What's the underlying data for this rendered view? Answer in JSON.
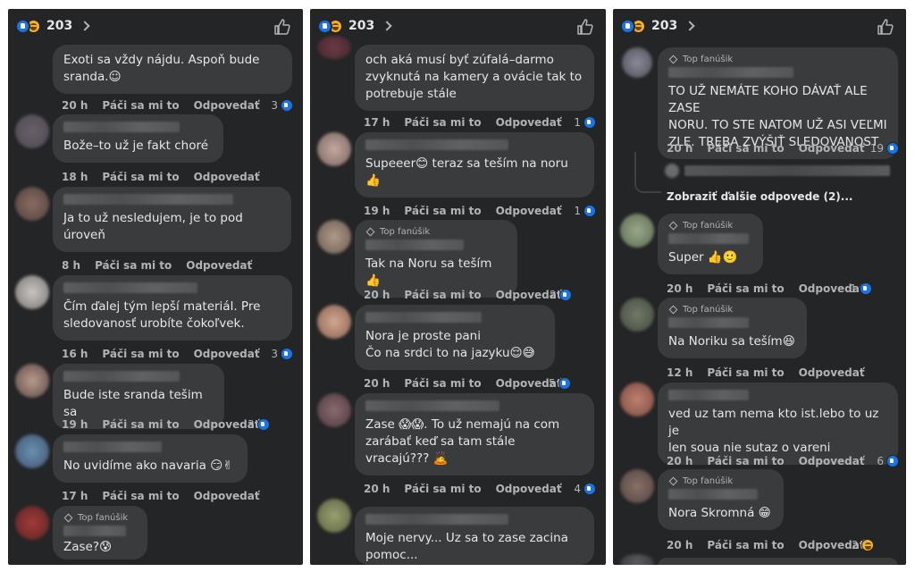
{
  "header": {
    "reaction_count": "203"
  },
  "actions": {
    "like": "Páči sa mi to",
    "reply": "Odpovedať"
  },
  "badge": {
    "top_fan": "Top fanúšik"
  },
  "panel1": {
    "c1": {
      "text": "Exoti sa vždy nájdu. Aspoň bude\nsranda.☺",
      "time": "20 h",
      "likes": "3"
    },
    "c2": {
      "text": "Bože–to už je fakt choré",
      "time": "18 h"
    },
    "c3": {
      "text": "Ja to už nesledujem, je to pod\núroveň",
      "time": "8 h"
    },
    "c4": {
      "text": "Čím ďalej tým lepší materiál. Pre\nsledovanosť urobíte čokoľvek.",
      "time": "16 h",
      "likes": "3"
    },
    "c5": {
      "text": "Bude iste sranda tešim sa",
      "time": "19 h",
      "likes": "3"
    },
    "c6": {
      "text": "No uvidíme ako navaria 😏✌",
      "time": "17 h"
    },
    "c7": {
      "text": "Zase?😰"
    }
  },
  "panel2": {
    "c1": {
      "text": "och aká musí byť zúfalá–darmo\nzvyknutá na kamery a ovácie tak to\npotrebuje stále",
      "time": "17 h",
      "likes": "1"
    },
    "c2": {
      "text": "Supeeer😊 teraz sa teším na noru\n👍",
      "time": "19 h",
      "likes": "1"
    },
    "c3": {
      "text": "Tak na Noru sa teším👍",
      "time": "20 h",
      "likes": "2"
    },
    "c4": {
      "text": "Nora je proste pani\nČo na srdci to na jazyku😌😅",
      "time": "20 h",
      "likes": "5"
    },
    "c5": {
      "text": "Zase 😱😱. To už nemajú na com\nzarábať keď sa tam stále\nvracajú??? 🙇",
      "time": "20 h",
      "likes": "4"
    },
    "c6": {
      "text": "Moje nervy... Uz sa to zase zacina\npomoc..."
    }
  },
  "panel3": {
    "c1": {
      "text": "TO UŽ NEMÁTE KOHO DÁVAŤ ALE ZASE\nNORU. TO STE NATOM UŽ ASI VEĽMI\nZLE. TREBA ZVÝŠIŤ SLEDOVANOST",
      "time": "20 h",
      "likes": "19"
    },
    "more_replies": "Zobraziť ďalšie odpovede (2)...",
    "c2": {
      "text": "Super 👍🙂",
      "time": "20 h",
      "likes": "1"
    },
    "c3": {
      "text": "Na Noriku sa teším😆",
      "time": "12 h"
    },
    "c4": {
      "text": "ved uz tam nema kto ist.lebo to uz je\nlen soua nie sutaz o vareni",
      "time": "20 h",
      "likes": "6"
    },
    "c5": {
      "text": "Nora Skromná 😁",
      "time": "20 h",
      "likes": "2"
    }
  },
  "colors": {
    "panel_bg": "#242526",
    "bubble_bg": "#3a3b3c",
    "text": "#e4e6eb",
    "meta": "#b0b3b8",
    "like_blue": "#1b74e4",
    "haha_yellow": "#f7b125"
  },
  "icons": [
    "like-reaction-icon",
    "haha-reaction-icon",
    "chevron-right-icon",
    "thumbs-up-outline-icon",
    "diamond-icon"
  ]
}
